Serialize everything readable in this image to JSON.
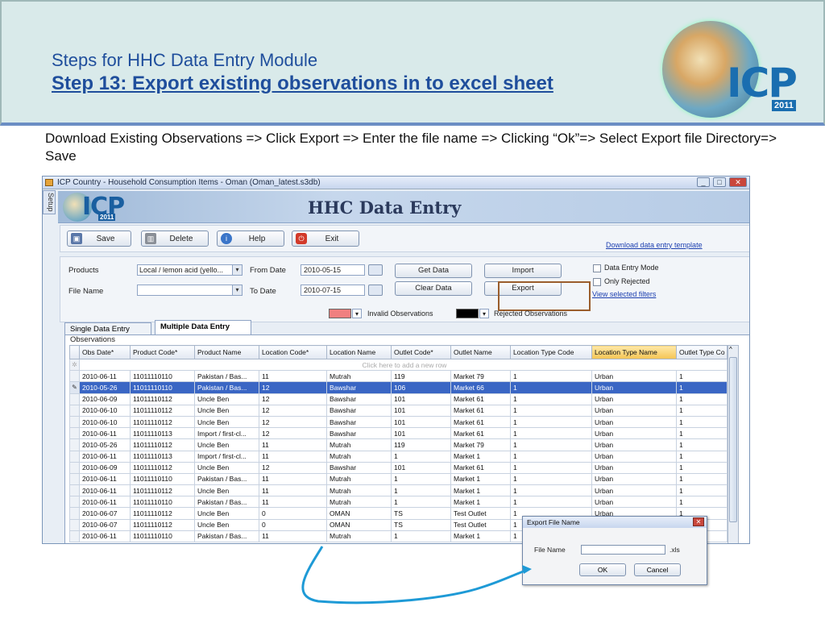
{
  "slide": {
    "title": "Steps for HHC Data Entry Module",
    "subtitle": "Step  13: Export existing observations in to excel sheet",
    "logo_text": "ICP",
    "logo_year": "2011",
    "instruction": "Download Existing Observations => Click Export => Enter the file name => Clicking “Ok”=> Select Export file Directory=> Save"
  },
  "window": {
    "title": "ICP Country - Household Consumption Items - Oman (Oman_latest.s3db)",
    "setup_tab": "Setup",
    "banner_title": "HHC Data Entry",
    "banner_logo_text": "ICP",
    "banner_logo_year": "2011"
  },
  "toolbar": {
    "save": "Save",
    "delete": "Delete",
    "help": "Help",
    "exit": "Exit",
    "download_template": "Download data entry template"
  },
  "filters": {
    "products_label": "Products",
    "products_value": "Local / lemon acid (yello...",
    "file_name_label": "File Name",
    "file_name_value": "",
    "from_date_label": "From Date",
    "from_date_value": "2010-05-15",
    "to_date_label": "To Date",
    "to_date_value": "2010-07-15",
    "get_data": "Get Data",
    "clear_data": "Clear Data",
    "import": "Import",
    "export": "Export",
    "data_entry_mode": "Data Entry Mode",
    "only_rejected": "Only Rejected",
    "view_selected_filters": "View selected filters",
    "invalid_observations": "Invalid Observations",
    "rejected_observations": "Rejected Observations",
    "invalid_color": "#f08080",
    "rejected_color": "#000000"
  },
  "tabs": {
    "single": "Single Data Entry",
    "multiple": "Multiple Data Entry"
  },
  "observations": {
    "legend": "Observations",
    "new_row_hint": "Click here to add a new row",
    "columns": [
      "Obs Date*",
      "Product Code*",
      "Product Name",
      "Location Code*",
      "Location Name",
      "Outlet Code*",
      "Outlet Name",
      "Location Type Code",
      "Location Type Name",
      "Outlet Type Co"
    ],
    "rows": [
      [
        "2010-06-11",
        "11011110110",
        "Pakistan / Bas...",
        "11",
        "Mutrah",
        "119",
        "Market 79",
        "1",
        "Urban",
        "1"
      ],
      [
        "2010-05-26",
        "11011110110",
        "Pakistan / Bas...",
        "12",
        "Bawshar",
        "106",
        "Market 66",
        "1",
        "Urban",
        "1"
      ],
      [
        "2010-06-09",
        "11011110112",
        "Uncle Ben",
        "12",
        "Bawshar",
        "101",
        "Market 61",
        "1",
        "Urban",
        "1"
      ],
      [
        "2010-06-10",
        "11011110112",
        "Uncle Ben",
        "12",
        "Bawshar",
        "101",
        "Market 61",
        "1",
        "Urban",
        "1"
      ],
      [
        "2010-06-10",
        "11011110112",
        "Uncle Ben",
        "12",
        "Bawshar",
        "101",
        "Market 61",
        "1",
        "Urban",
        "1"
      ],
      [
        "2010-06-11",
        "11011110113",
        "Import / first-cl...",
        "12",
        "Bawshar",
        "101",
        "Market 61",
        "1",
        "Urban",
        "1"
      ],
      [
        "2010-05-26",
        "11011110112",
        "Uncle Ben",
        "11",
        "Mutrah",
        "119",
        "Market 79",
        "1",
        "Urban",
        "1"
      ],
      [
        "2010-06-11",
        "11011110113",
        "Import / first-cl...",
        "11",
        "Mutrah",
        "1",
        "Market 1",
        "1",
        "Urban",
        "1"
      ],
      [
        "2010-06-09",
        "11011110112",
        "Uncle Ben",
        "12",
        "Bawshar",
        "101",
        "Market 61",
        "1",
        "Urban",
        "1"
      ],
      [
        "2010-06-11",
        "11011110110",
        "Pakistan / Bas...",
        "11",
        "Mutrah",
        "1",
        "Market 1",
        "1",
        "Urban",
        "1"
      ],
      [
        "2010-06-11",
        "11011110112",
        "Uncle Ben",
        "11",
        "Mutrah",
        "1",
        "Market 1",
        "1",
        "Urban",
        "1"
      ],
      [
        "2010-06-11",
        "11011110110",
        "Pakistan / Bas...",
        "11",
        "Mutrah",
        "1",
        "Market 1",
        "1",
        "Urban",
        "1"
      ],
      [
        "2010-06-07",
        "11011110112",
        "Uncle Ben",
        "0",
        "OMAN",
        "TS",
        "Test Outlet",
        "1",
        "Urban",
        "1"
      ],
      [
        "2010-06-07",
        "11011110112",
        "Uncle Ben",
        "0",
        "OMAN",
        "TS",
        "Test Outlet",
        "1",
        "",
        ""
      ],
      [
        "2010-06-11",
        "11011110110",
        "Pakistan / Bas...",
        "11",
        "Mutrah",
        "1",
        "Market 1",
        "1",
        "",
        ""
      ]
    ]
  },
  "dialog": {
    "title": "Export File Name",
    "file_name_label": "File Name",
    "file_name_value": "",
    "extension": ".xls",
    "ok": "OK",
    "cancel": "Cancel"
  }
}
